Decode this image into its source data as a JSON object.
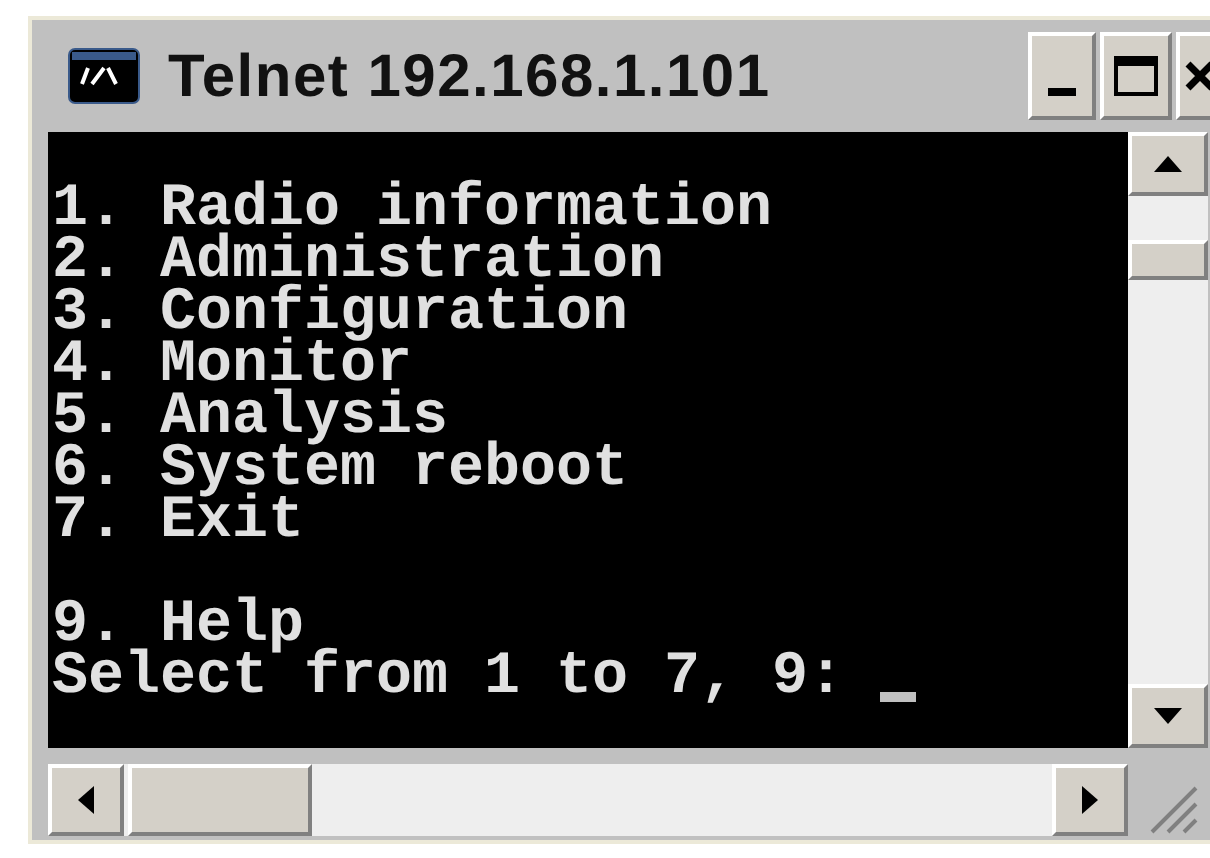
{
  "window": {
    "title": "Telnet 192.168.1.101"
  },
  "console": {
    "menu_groups": [
      [
        "1. Radio information",
        "2. Administration",
        "3. Configuration",
        "4. Monitor",
        "5. Analysis",
        "6. System reboot",
        "7. Exit"
      ],
      [
        "9. Help"
      ]
    ],
    "prompt": "Select from 1 to 7, 9:"
  }
}
